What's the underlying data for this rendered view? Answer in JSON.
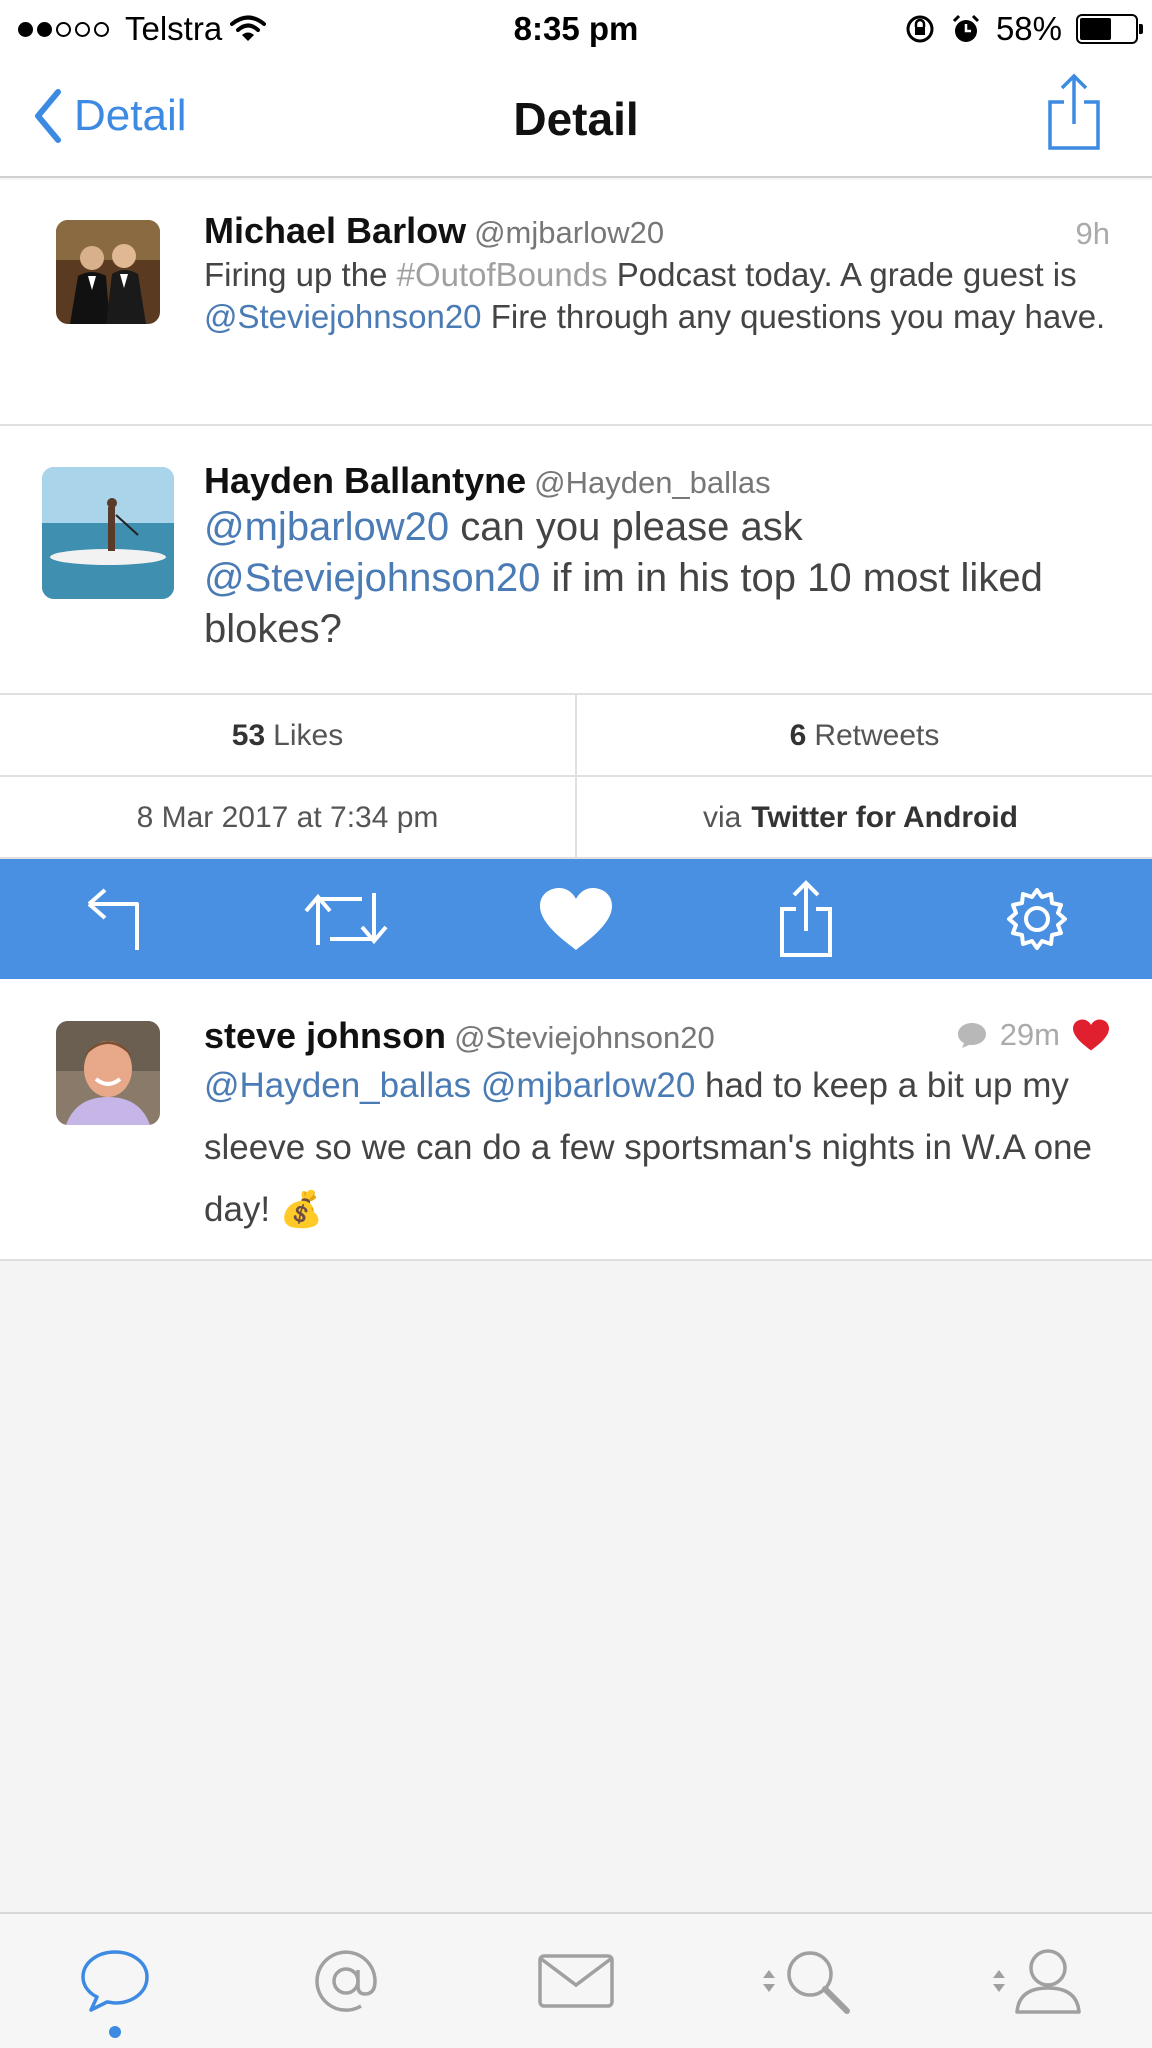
{
  "status_bar": {
    "carrier": "Telstra",
    "time": "8:35 pm",
    "battery": "58%",
    "battery_level": 0.58,
    "signal_bars_filled": 2,
    "signal_bars_total": 5
  },
  "nav": {
    "back_label": "Detail",
    "title": "Detail"
  },
  "parent_tweet": {
    "name": "Michael Barlow",
    "handle": "@mjbarlow20",
    "time": "9h",
    "text_1": "Firing up the ",
    "hashtag": "#OutofBounds",
    "text_2": " Podcast today. A grade guest is ",
    "mention": "@Steviejohnson20",
    "text_3": " Fire through any questions you may have."
  },
  "main_tweet": {
    "name": "Hayden Ballantyne",
    "handle": "@Hayden_ballas",
    "mention_1": "@mjbarlow20",
    "text_1": " can you please ask ",
    "mention_2": "@Steviejohnson20",
    "text_2": "  if im in his top 10 most liked blokes?"
  },
  "stats": {
    "likes_count": "53",
    "likes_label": "Likes",
    "retweets_count": "6",
    "retweets_label": "Retweets",
    "date": "8 Mar 2017 at 7:34 pm",
    "via_label": "via",
    "source": "Twitter for Android"
  },
  "actions": {
    "icons": [
      "reply-icon",
      "retweet-icon",
      "heart-icon",
      "share-icon",
      "gear-icon"
    ],
    "bar_color": "#4a90e2"
  },
  "reply_tweet": {
    "name": "steve johnson",
    "handle": "@Steviejohnson20",
    "time": "29m",
    "mention_1": "@Hayden_ballas",
    "mention_2": "@mjbarlow20",
    "text": " had to keep a bit up my sleeve so we can do a few sportsman's nights in W.A one day! ",
    "emoji": "💰",
    "liked": true
  },
  "tab_bar": {
    "tabs": [
      "timeline-icon",
      "mentions-icon",
      "messages-icon",
      "search-icon",
      "profile-icon"
    ],
    "active_index": 0
  },
  "colors": {
    "accent": "#3d8ae3",
    "mention": "#4a7bb5",
    "like_red": "#e0202e"
  }
}
